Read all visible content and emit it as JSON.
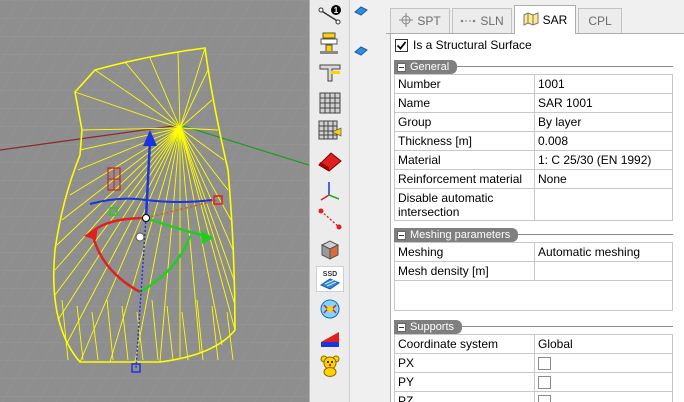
{
  "tabs": [
    {
      "label": "SPT",
      "icon": "point-target-icon"
    },
    {
      "label": "SLN",
      "icon": "line-icon"
    },
    {
      "label": "SAR",
      "icon": "surface-map-icon",
      "active": true
    },
    {
      "label": "CPL",
      "icon": ""
    }
  ],
  "structural": {
    "label": "Is a Structural Surface",
    "checked": true
  },
  "general": {
    "title": "General",
    "rows": [
      {
        "key": "Number",
        "value": "1001"
      },
      {
        "key": "Name",
        "value": "SAR 1001"
      },
      {
        "key": "Group",
        "value": "By layer"
      },
      {
        "key": "Thickness [m]",
        "value": "0.008"
      },
      {
        "key": "Material",
        "value": "1: C 25/30 (EN 1992)"
      },
      {
        "key": "Reinforcement material",
        "value": "None"
      },
      {
        "key": "Disable automatic intersection",
        "value": ""
      }
    ]
  },
  "meshing": {
    "title": "Meshing parameters",
    "rows": [
      {
        "key": "Meshing",
        "value": "Automatic meshing"
      },
      {
        "key": "Mesh density [m]",
        "value": ""
      }
    ]
  },
  "supports": {
    "title": "Supports",
    "rows": [
      {
        "key": "Coordinate system",
        "value": "Global"
      },
      {
        "key": "PX",
        "value": ""
      },
      {
        "key": "PY",
        "value": ""
      },
      {
        "key": "PZ",
        "value": ""
      }
    ]
  },
  "toolbar": {
    "ssd_label": "SSD",
    "badge_number": "1"
  },
  "colors": {
    "surface": "#ffff00",
    "axis_x": "#e02020",
    "axis_y": "#22cc22",
    "axis_z": "#1a35e0",
    "viewport_bg": "#8e8e8e"
  }
}
